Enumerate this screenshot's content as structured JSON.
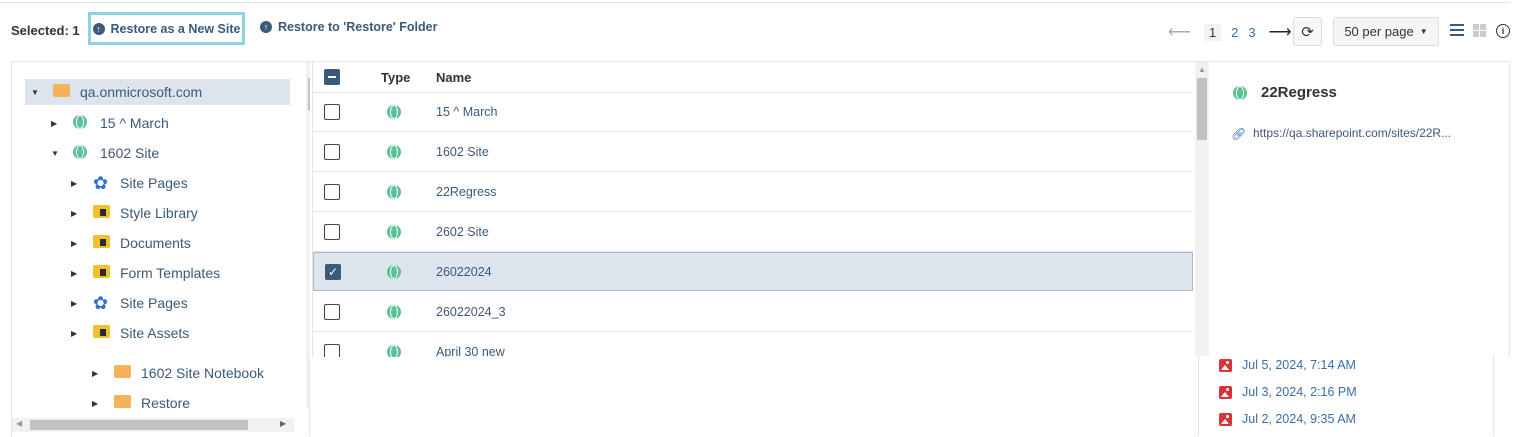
{
  "toolbar": {
    "selected_label": "Selected: 1",
    "restore_new_site": "Restore as a New Site",
    "restore_folder": "Restore to 'Restore' Folder",
    "pages": [
      "1",
      "2",
      "3"
    ],
    "per_page": "50 per page"
  },
  "tree": {
    "root": "qa.onmicrosoft.com",
    "items": [
      {
        "label": "15 ^ March",
        "icon": "globe-icon"
      },
      {
        "label": "1602 Site",
        "icon": "globe-icon"
      },
      {
        "label": "Site Pages",
        "icon": "flower-icon"
      },
      {
        "label": "Style Library",
        "icon": "doc-folder-icon"
      },
      {
        "label": "Documents",
        "icon": "doc-folder-icon"
      },
      {
        "label": "Form Templates",
        "icon": "doc-folder-icon"
      },
      {
        "label": "Site Pages",
        "icon": "flower-icon"
      },
      {
        "label": "Site Assets",
        "icon": "doc-folder-icon"
      },
      {
        "label": "1602 Site Notebook",
        "icon": "folder-icon"
      },
      {
        "label": "Restore",
        "icon": "folder-icon"
      }
    ]
  },
  "grid": {
    "headers": {
      "type": "Type",
      "name": "Name"
    },
    "rows": [
      {
        "name": "15 ^ March",
        "checked": false
      },
      {
        "name": "1602 Site",
        "checked": false
      },
      {
        "name": "22Regress",
        "checked": false
      },
      {
        "name": "2602 Site",
        "checked": false
      },
      {
        "name": "26022024",
        "checked": true
      },
      {
        "name": "26022024_3",
        "checked": false
      },
      {
        "name": "April 30 new",
        "checked": false
      }
    ]
  },
  "detail": {
    "title": "22Regress",
    "url": "https://qa.sharepoint.com/sites/22R..."
  },
  "versions": [
    "Jul 5, 2024, 7:14 AM",
    "Jul 3, 2024, 2:16 PM",
    "Jul 2, 2024, 9:35 AM"
  ],
  "colors": {
    "accent": "#3a5a7a",
    "selected_row": "#dde4ee",
    "highlight_border": "#8dd3e6"
  }
}
